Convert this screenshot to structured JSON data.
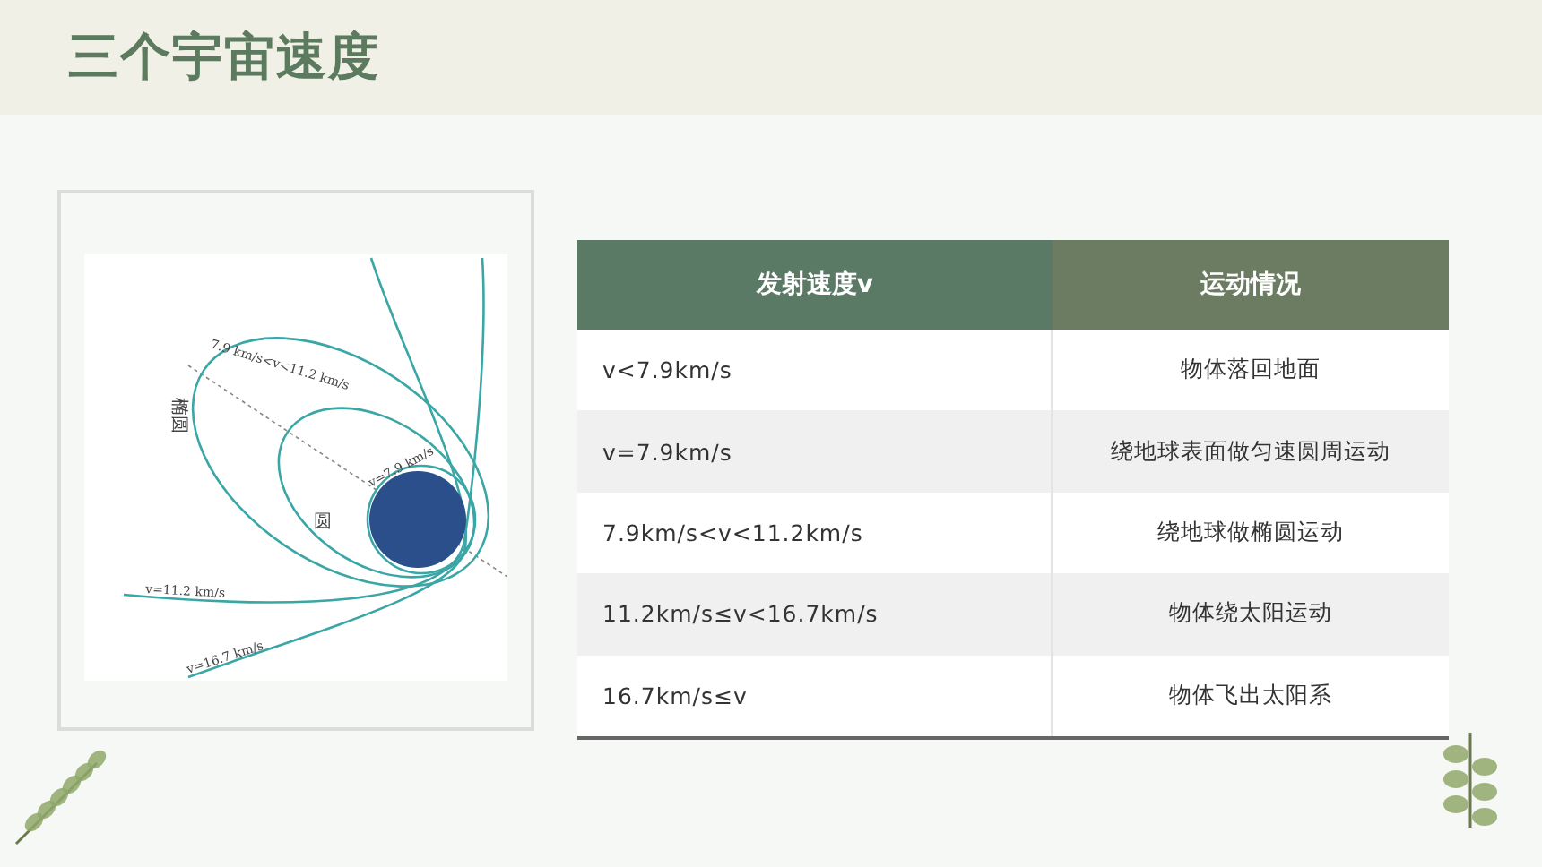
{
  "title": "三个宇宙速度",
  "figure": {
    "labels": [
      {
        "kind": "ellipse_range",
        "text": "7.9 km/s<v<11.2 km/s"
      },
      {
        "kind": "ellipse_name",
        "text": "椭圆"
      },
      {
        "kind": "circle_speed",
        "text": "v=7.9 km/s"
      },
      {
        "kind": "circle_name",
        "text": "圆"
      },
      {
        "kind": "escape",
        "text": "v=11.2 km/s"
      },
      {
        "kind": "solar_escape",
        "text": "v=16.7 km/s"
      }
    ]
  },
  "table": {
    "columns": [
      "发射速度v",
      "运动情况"
    ],
    "rows": [
      [
        "v<7.9km/s",
        "物体落回地面"
      ],
      [
        "v=7.9km/s",
        "绕地球表面做匀速圆周运动"
      ],
      [
        "7.9km/s<v<11.2km/s",
        "绕地球做椭圆运动"
      ],
      [
        "11.2km/s≤v<16.7km/s",
        "物体绕太阳运动"
      ],
      [
        "16.7km/s≤v",
        "物体飞出太阳系"
      ]
    ]
  }
}
